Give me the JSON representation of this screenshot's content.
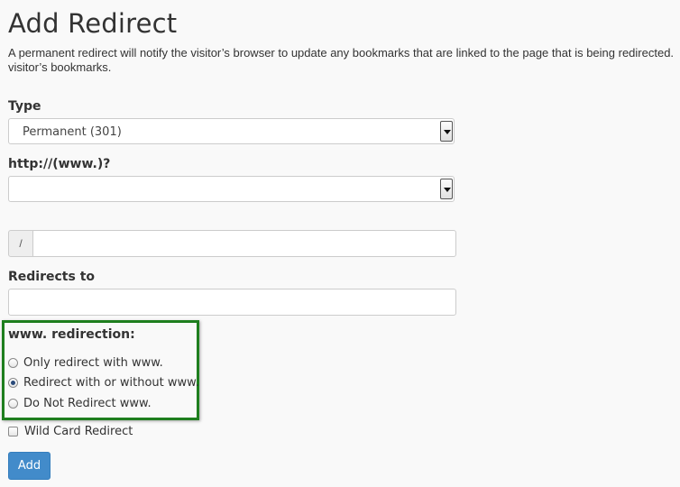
{
  "page": {
    "title": "Add Redirect",
    "description": "A permanent redirect will notify the visitor’s browser to update any bookmarks that are linked to the page that is being redirected. visitor’s bookmarks."
  },
  "type_field": {
    "label": "Type",
    "selected": "Permanent (301)"
  },
  "domain_field": {
    "label": "http://(www.)?",
    "selected": ""
  },
  "path_field": {
    "prefix": "/",
    "value": ""
  },
  "redirects_to": {
    "label": "Redirects to",
    "value": ""
  },
  "www_redirection": {
    "label": "www. redirection:",
    "options": [
      {
        "label": "Only redirect with www.",
        "checked": false
      },
      {
        "label": "Redirect with or without www.",
        "checked": true
      },
      {
        "label": "Do Not Redirect www.",
        "checked": false
      }
    ],
    "highlight_color": "#1e7e1e"
  },
  "wildcard": {
    "label": "Wild Card Redirect",
    "checked": false
  },
  "actions": {
    "add_label": "Add",
    "accent_color": "#428bca"
  }
}
